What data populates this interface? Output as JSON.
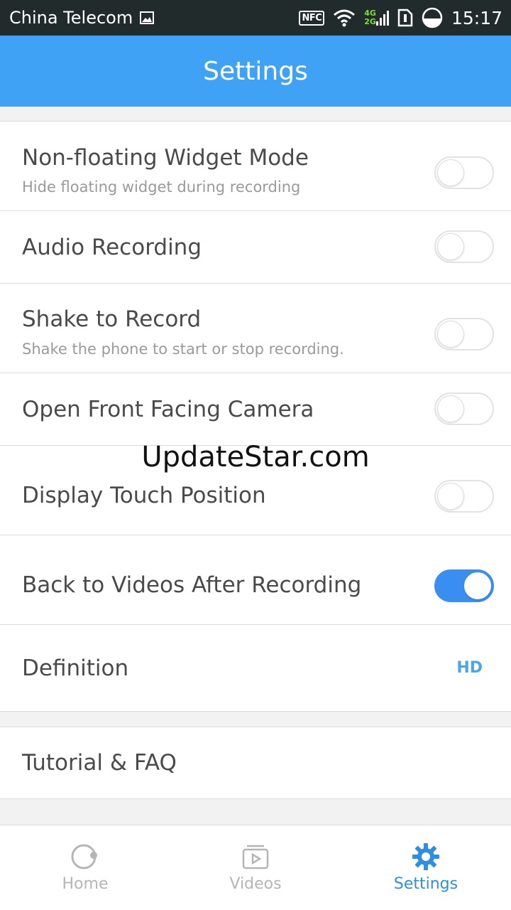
{
  "status": {
    "carrier": "China Telecom",
    "time": "15:17",
    "nfc_label": "NFC",
    "net_top": "4G",
    "net_bottom": "2G"
  },
  "header": {
    "title": "Settings"
  },
  "settings": [
    {
      "title": "Non-floating Widget Mode",
      "subtitle": "Hide floating widget during recording",
      "toggle": "off"
    },
    {
      "title": "Audio Recording",
      "toggle": "off"
    },
    {
      "title": "Shake to Record",
      "subtitle": "Shake the phone to start or stop recording.",
      "toggle": "off"
    },
    {
      "title": "Open Front Facing Camera",
      "toggle": "off"
    },
    {
      "title": "Display Touch Position",
      "toggle": "off"
    },
    {
      "title": "Back to Videos After Recording",
      "toggle": "on"
    },
    {
      "title": "Definition",
      "value": "HD"
    }
  ],
  "help": {
    "title": "Tutorial & FAQ"
  },
  "watermark": "UpdateStar.com",
  "tabs": [
    {
      "label": "Home",
      "icon": "record-icon",
      "active": false
    },
    {
      "label": "Videos",
      "icon": "video-player-icon",
      "active": false
    },
    {
      "label": "Settings",
      "icon": "gear-icon",
      "active": true
    }
  ],
  "colors": {
    "header": "#3fa2f4",
    "accent": "#2f8fde",
    "toggle_on": "#3a8ef0",
    "status_bar": "#222b2b"
  }
}
